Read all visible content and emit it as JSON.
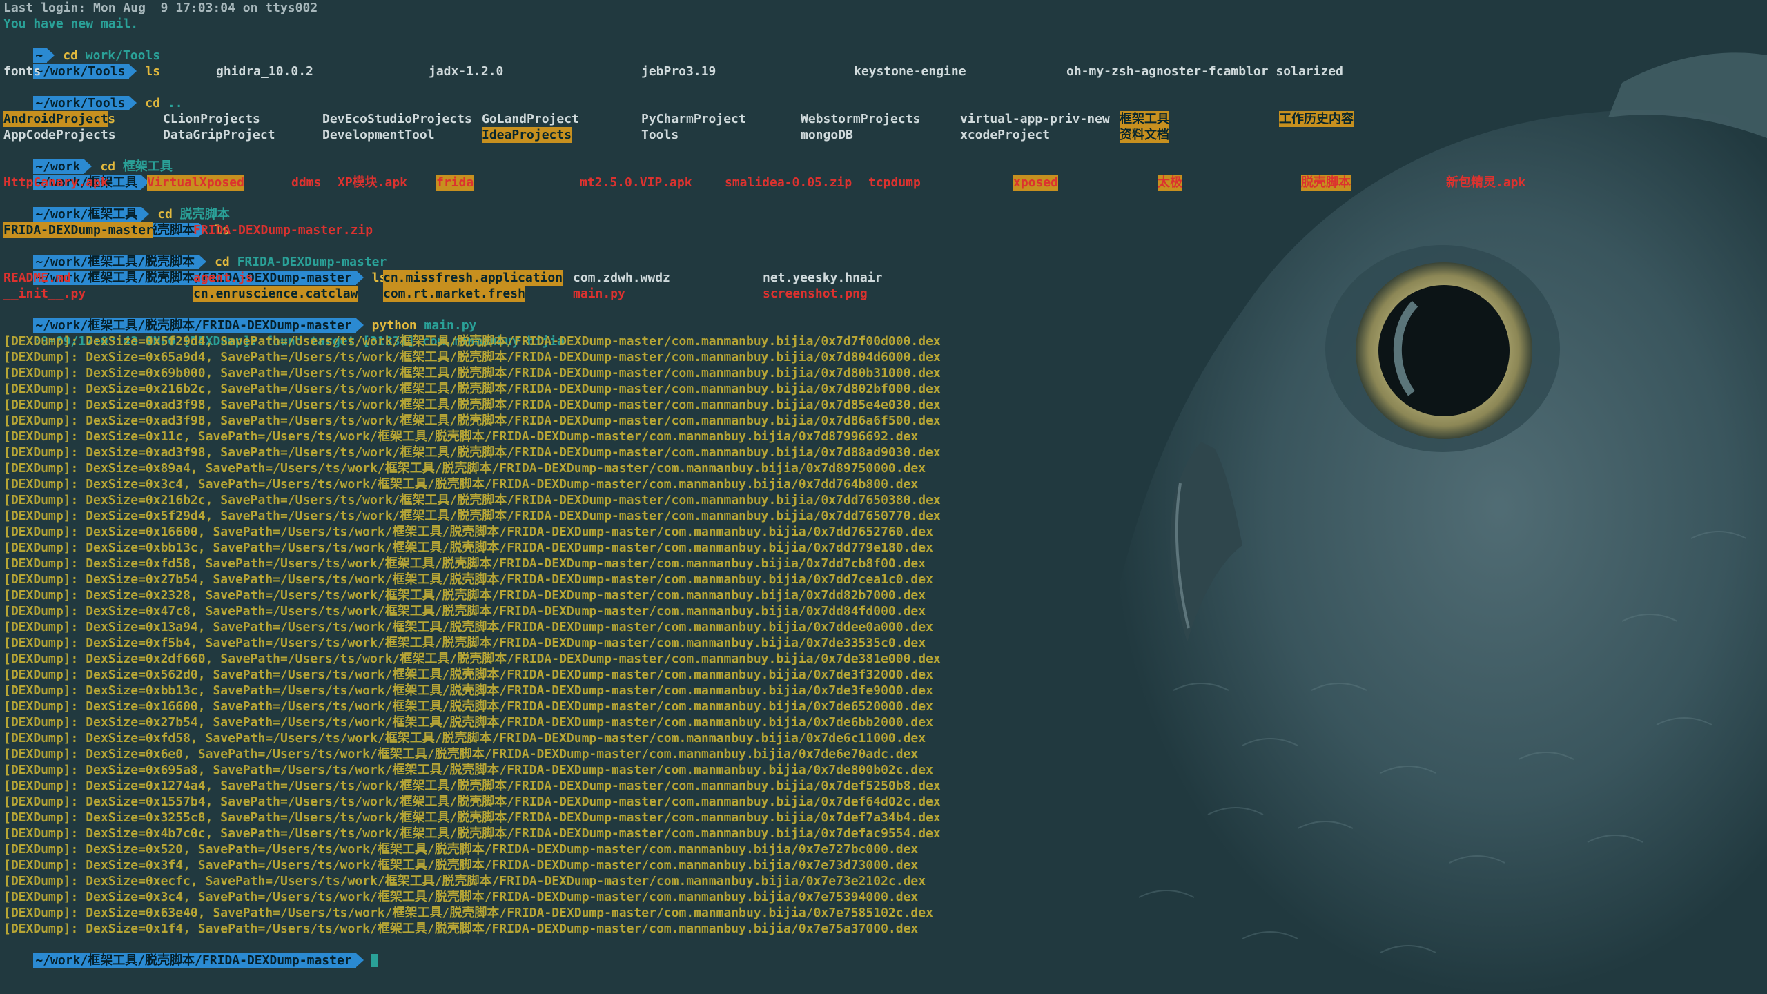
{
  "colors": {
    "background": "#21393f",
    "prompt": "#2b8ad2",
    "command": "#e2b93d",
    "directory": "#2aa198",
    "highlight": "#c7901f",
    "error_red": "#dc322f",
    "dex_text": "#b6a535",
    "owl_eye": "#d6cf9a"
  },
  "header": {
    "last_login": "Last login: Mon Aug  9 17:03:04 on ttys002",
    "mail": "You have new mail."
  },
  "prompts": {
    "home": "~",
    "tools": "~/work/Tools",
    "work": "~/work",
    "framework": "~/work/框架工具",
    "unpack": "~/work/框架工具/脱壳脚本",
    "dexdump": "~/work/框架工具/脱壳脚本/FRIDA-DEXDump-master"
  },
  "commands": {
    "c1": "cd",
    "c1_arg": "work/Tools",
    "c2": "ls",
    "c3": "cd",
    "c3_arg": "..",
    "c4": "ls",
    "c5": "cd",
    "c5_arg": "框架工具",
    "c6": "ls",
    "c7": "cd",
    "c7_arg": "脱壳脚本",
    "c8": "ls",
    "c9": "cd",
    "c9_arg": "FRIDA-DEXDump-master",
    "c10": "ls",
    "c11": "python",
    "c11_arg": "main.py"
  },
  "ls_tools": [
    "fonts",
    "ghidra_10.0.2",
    "jadx-1.2.0",
    "jebPro3.19",
    "keystone-engine",
    "oh-my-zsh-agnoster-fcamblor solarized"
  ],
  "ls_work_row1": [
    "AndroidProject",
    "CLionProjects",
    "DevEcoStudioProjects",
    "GoLandProject",
    "PyCharmProject",
    "WebstormProjects",
    "virtual-app-priv-new",
    "框架工具",
    "工作历史内容"
  ],
  "ls_work_row2": [
    "AppCodeProjects",
    "DataGripProject",
    "DevelopmentTool",
    "IdeaProjects",
    "Tools",
    "mongoDB",
    "xcodeProject",
    "资料文档"
  ],
  "ls_framework": [
    "HttpCanary.apk",
    "VirtualXposed",
    "ddms",
    "XP模块.apk",
    "frida",
    "mt2.5.0.VIP.apk",
    "smalidea-0.05.zip",
    "tcpdump",
    "xposed",
    "太极",
    "脱壳脚本",
    "新包精灵.apk"
  ],
  "ls_unpack": [
    "FRIDA-DEXDump-master",
    "FRIDA-DEXDump-master.zip"
  ],
  "ls_dexdump_row1": [
    "README.md",
    "agent.js",
    "cn.missfresh.application",
    "com.zdwh.wwdz",
    "net.yeesky.hnair"
  ],
  "ls_dexdump_row2": [
    "__init__.py",
    "cn.enruscience.catclaw",
    "com.rt.market.fresh",
    "main.py",
    "screenshot.png"
  ],
  "info_line": {
    "text": "08-09/17:03:43 INFO [DEXDump]: found target [31831]",
    "pkg": "com.manmanbuy.bijia"
  },
  "dex_prefix": "[DEXDump]: DexSize=",
  "dex_path": "Users/ts/work/框架工具/脱壳脚本/FRIDA-DEXDump-master/com.manmanbuy.bijia/",
  "dex_lines": [
    {
      "size": "0x5f29d4",
      "file": "0x7d7f00d000.dex"
    },
    {
      "size": "0x65a9d4",
      "file": "0x7d804d6000.dex"
    },
    {
      "size": "0x69b000",
      "file": "0x7d80b31000.dex"
    },
    {
      "size": "0x216b2c",
      "file": "0x7d802bf000.dex"
    },
    {
      "size": "0xad3f98",
      "file": "0x7d85e4e030.dex"
    },
    {
      "size": "0xad3f98",
      "file": "0x7d86a6f500.dex"
    },
    {
      "size": "0x11c",
      "file": "0x7d87996692.dex"
    },
    {
      "size": "0xad3f98",
      "file": "0x7d88ad9030.dex"
    },
    {
      "size": "0x89a4",
      "file": "0x7d89750000.dex"
    },
    {
      "size": "0x3c4",
      "file": "0x7dd764b800.dex"
    },
    {
      "size": "0x216b2c",
      "file": "0x7dd7650380.dex"
    },
    {
      "size": "0x5f29d4",
      "file": "0x7dd7650770.dex"
    },
    {
      "size": "0x16600",
      "file": "0x7dd7652760.dex"
    },
    {
      "size": "0xbb13c",
      "file": "0x7dd779e180.dex"
    },
    {
      "size": "0xfd58",
      "file": "0x7dd7cb8f00.dex"
    },
    {
      "size": "0x27b54",
      "file": "0x7dd7cea1c0.dex"
    },
    {
      "size": "0x2328",
      "file": "0x7dd82b7000.dex"
    },
    {
      "size": "0x47c8",
      "file": "0x7dd84fd000.dex"
    },
    {
      "size": "0x13a94",
      "file": "0x7ddee0a000.dex"
    },
    {
      "size": "0xf5b4",
      "file": "0x7de33535c0.dex"
    },
    {
      "size": "0x2df660",
      "file": "0x7de381e000.dex"
    },
    {
      "size": "0x562d0",
      "file": "0x7de3f32000.dex"
    },
    {
      "size": "0xbb13c",
      "file": "0x7de3fe9000.dex"
    },
    {
      "size": "0x16600",
      "file": "0x7de6520000.dex"
    },
    {
      "size": "0x27b54",
      "file": "0x7de6bb2000.dex"
    },
    {
      "size": "0xfd58",
      "file": "0x7de6c11000.dex"
    },
    {
      "size": "0x6e0",
      "file": "0x7de6e70adc.dex"
    },
    {
      "size": "0x695a8",
      "file": "0x7de800b02c.dex"
    },
    {
      "size": "0x1274a4",
      "file": "0x7def5250b8.dex"
    },
    {
      "size": "0x1557b4",
      "file": "0x7def64d02c.dex"
    },
    {
      "size": "0x3255c8",
      "file": "0x7def7a34b4.dex"
    },
    {
      "size": "0x4b7c0c",
      "file": "0x7defac9554.dex"
    },
    {
      "size": "0x520",
      "file": "0x7e727bc000.dex"
    },
    {
      "size": "0x3f4",
      "file": "0x7e73d73000.dex"
    },
    {
      "size": "0xecfc",
      "file": "0x7e73e2102c.dex"
    },
    {
      "size": "0x3c4",
      "file": "0x7e75394000.dex"
    },
    {
      "size": "0x63e40",
      "file": "0x7e7585102c.dex"
    },
    {
      "size": "0x1f4",
      "file": "0x7e75a37000.dex"
    }
  ]
}
